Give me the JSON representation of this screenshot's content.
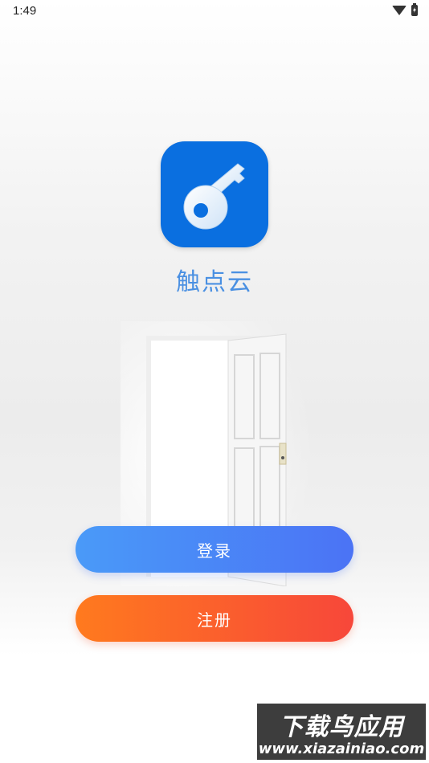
{
  "status_bar": {
    "time": "1:49"
  },
  "app": {
    "name": "触点云"
  },
  "buttons": {
    "login": "登录",
    "register": "注册"
  },
  "watermark": {
    "title": "下载鸟应用",
    "url": "www.xiazainiao.com"
  },
  "colors": {
    "logo_bg": "#0a6fe0",
    "app_name": "#4a90e2",
    "login_gradient": [
      "#4a9af8",
      "#4b73f5"
    ],
    "register_gradient": [
      "#ff7a1e",
      "#f7473a"
    ]
  },
  "icons": [
    "wifi-icon",
    "battery-icon",
    "key-icon"
  ]
}
